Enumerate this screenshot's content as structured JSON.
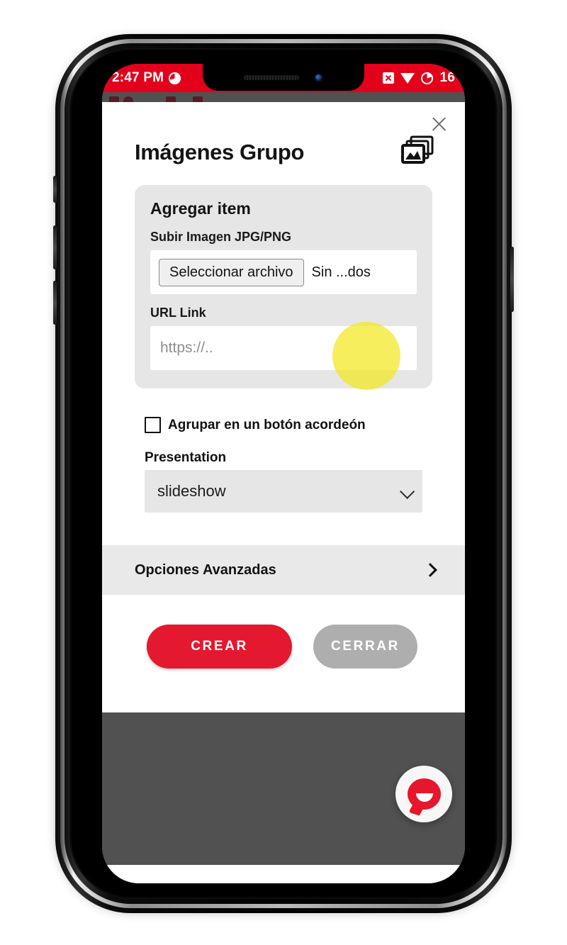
{
  "status_bar": {
    "time": "2:47 PM",
    "left_icon": "pie-clock-icon",
    "right_icons": [
      "x-box-icon",
      "triangle-down-icon",
      "pie-battery-icon"
    ],
    "battery_number": "16",
    "background_color": "#e3001b"
  },
  "modal": {
    "title": "Imágenes Grupo",
    "title_icon": "images-stack-icon",
    "close_icon": "close-icon",
    "panel": {
      "heading": "Agregar item",
      "upload_label": "Subir Imagen JPG/PNG",
      "file_button": "Seleccionar archivo",
      "file_status": "Sin ...dos",
      "url_label": "URL Link",
      "url_value": "",
      "url_placeholder": "https://.."
    },
    "checkbox": {
      "label": "Agrupar en un botón acordeón",
      "checked": false
    },
    "presentation": {
      "label": "Presentation",
      "selected": "slideshow",
      "options": [
        "slideshow"
      ]
    },
    "advanced": {
      "label": "Opciones Avanzadas",
      "chevron": "chevron-right-icon"
    },
    "actions": {
      "primary": "CREAR",
      "primary_color": "#e4182f",
      "secondary": "CERRAR",
      "secondary_color": "#aeaeae"
    }
  },
  "background": {
    "fab_icon": "chat-bubble-icon",
    "fab_color": "#e8162c"
  },
  "highlight": {
    "shape": "circle",
    "color": "#f2e71d",
    "target": "Seleccionar archivo"
  }
}
